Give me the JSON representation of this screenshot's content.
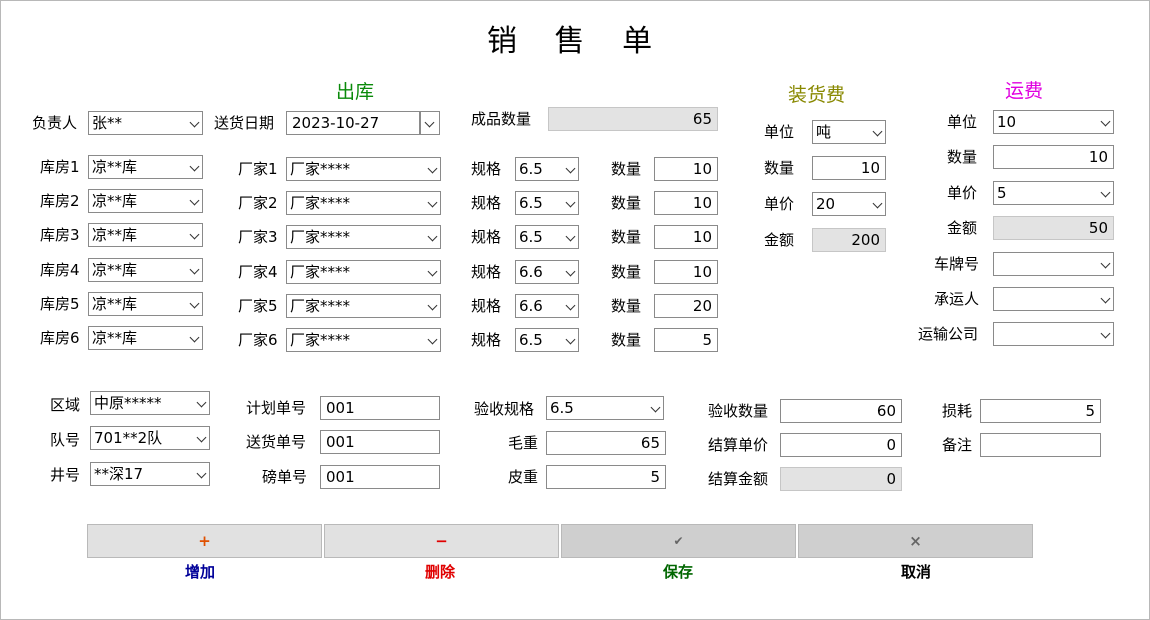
{
  "title": "销 售 单",
  "sections": {
    "outbound": "出库",
    "loading_fee": "装货费",
    "freight": "运费"
  },
  "colors": {
    "outbound": "#0a8a0a",
    "loading_fee": "#888800",
    "freight": "#e000e0",
    "add": "#000099",
    "delete": "#e00000",
    "save": "#006600",
    "cancel": "#000000"
  },
  "header": {
    "person_label": "负责人",
    "person": "张**",
    "date_label": "送货日期",
    "date": "2023-10-27",
    "qty_label": "成品数量",
    "qty": "65"
  },
  "rows": [
    {
      "store_label": "库房1",
      "store": "凉**库",
      "maker_label": "厂家1",
      "maker": "厂家****",
      "spec_label": "规格",
      "spec": "6.5",
      "qty_label": "数量",
      "qty": "10"
    },
    {
      "store_label": "库房2",
      "store": "凉**库",
      "maker_label": "厂家2",
      "maker": "厂家****",
      "spec_label": "规格",
      "spec": "6.5",
      "qty_label": "数量",
      "qty": "10"
    },
    {
      "store_label": "库房3",
      "store": "凉**库",
      "maker_label": "厂家3",
      "maker": "厂家****",
      "spec_label": "规格",
      "spec": "6.5",
      "qty_label": "数量",
      "qty": "10"
    },
    {
      "store_label": "库房4",
      "store": "凉**库",
      "maker_label": "厂家4",
      "maker": "厂家****",
      "spec_label": "规格",
      "spec": "6.6",
      "qty_label": "数量",
      "qty": "10"
    },
    {
      "store_label": "库房5",
      "store": "凉**库",
      "maker_label": "厂家5",
      "maker": "厂家****",
      "spec_label": "规格",
      "spec": "6.6",
      "qty_label": "数量",
      "qty": "20"
    },
    {
      "store_label": "库房6",
      "store": "凉**库",
      "maker_label": "厂家6",
      "maker": "厂家****",
      "spec_label": "规格",
      "spec": "6.5",
      "qty_label": "数量",
      "qty": "5"
    }
  ],
  "loading": {
    "unit_label": "单位",
    "unit": "吨",
    "qty_label": "数量",
    "qty": "10",
    "price_label": "单价",
    "price": "20",
    "amount_label": "金额",
    "amount": "200"
  },
  "freight": {
    "unit_label": "单位",
    "unit": "10",
    "qty_label": "数量",
    "qty": "10",
    "price_label": "单价",
    "price": "5",
    "amount_label": "金额",
    "amount": "50",
    "plate_label": "车牌号",
    "plate": "",
    "carrier_label": "承运人",
    "carrier": "",
    "company_label": "运输公司",
    "company": ""
  },
  "bottom": {
    "region_label": "区域",
    "region": "中原*****",
    "team_label": "队号",
    "team": "701**2队",
    "well_label": "井号",
    "well": "**深17",
    "plan_label": "计划单号",
    "plan": "001",
    "delivery_label": "送货单号",
    "delivery": "001",
    "weigh_label": "磅单号",
    "weigh": "001",
    "accept_spec_label": "验收规格",
    "accept_spec": "6.5",
    "gross_label": "毛重",
    "gross": "65",
    "tare_label": "皮重",
    "tare": "5",
    "accept_qty_label": "验收数量",
    "accept_qty": "60",
    "settle_price_label": "结算单价",
    "settle_price": "0",
    "settle_amount_label": "结算金额",
    "settle_amount": "0",
    "loss_label": "损耗",
    "loss": "5",
    "note_label": "备注",
    "note": ""
  },
  "buttons": [
    {
      "icon": "+",
      "label": "增加"
    },
    {
      "icon": "−",
      "label": "删除"
    },
    {
      "icon": "✔",
      "label": "保存"
    },
    {
      "icon": "×",
      "label": "取消"
    }
  ]
}
